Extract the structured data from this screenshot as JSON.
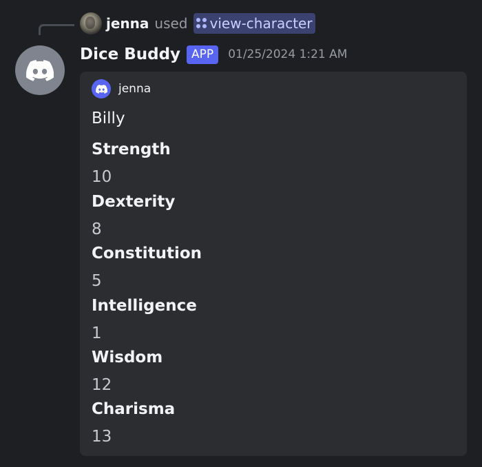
{
  "reply": {
    "username": "jenna",
    "used_text": "used",
    "command": "view-character"
  },
  "header": {
    "bot_name": "Dice Buddy",
    "app_tag": "APP",
    "timestamp": "01/25/2024 1:21 AM"
  },
  "embed": {
    "author": "jenna",
    "title": "Billy",
    "fields": [
      {
        "name": "Strength",
        "value": "10"
      },
      {
        "name": "Dexterity",
        "value": "8"
      },
      {
        "name": "Constitution",
        "value": "5"
      },
      {
        "name": "Intelligence",
        "value": "1"
      },
      {
        "name": "Wisdom",
        "value": "12"
      },
      {
        "name": "Charisma",
        "value": "13"
      }
    ]
  },
  "icons": {
    "bot_avatar": "discord-logo-icon",
    "author_icon": "discord-logo-icon",
    "command_icon": "app-command-icon"
  },
  "colors": {
    "background": "#1e1f23",
    "embed_background": "#2b2d31",
    "blurple": "#5865f2",
    "command_pill": "#3c4270"
  }
}
